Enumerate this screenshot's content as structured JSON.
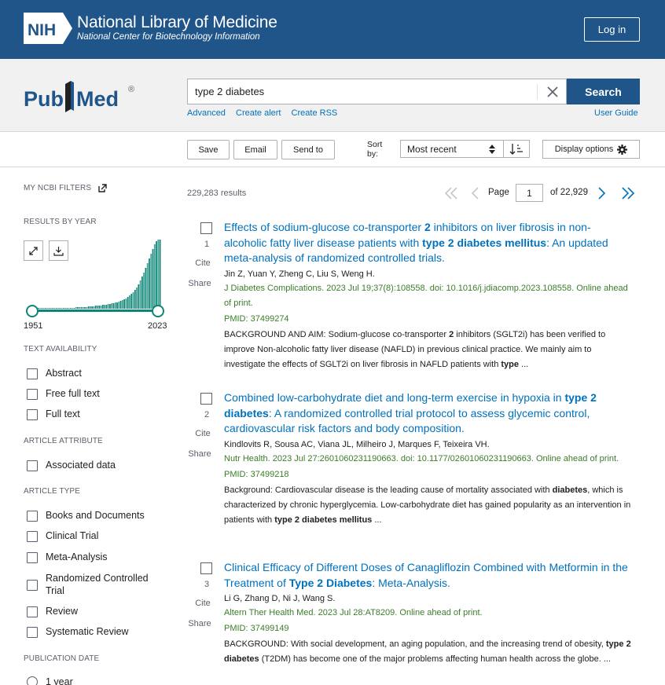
{
  "header": {
    "nih_logo_text": "NIH",
    "title": "National Library of Medicine",
    "subtitle": "National Center for Biotechnology Information",
    "login_label": "Log in"
  },
  "search": {
    "logo_text_pub": "Pub",
    "logo_text_med": "Med",
    "logo_reg": "®",
    "query": "type 2 diabetes",
    "button_label": "Search",
    "links": [
      "Advanced",
      "Create alert",
      "Create RSS"
    ],
    "user_guide": "User Guide"
  },
  "toolbar": {
    "save": "Save",
    "email": "Email",
    "send_to": "Send to",
    "sort_by_label": "Sort by:",
    "sort_value": "Most recent",
    "display_options": "Display options"
  },
  "sidebar": {
    "my_filters": "MY NCBI FILTERS",
    "results_by_year": "RESULTS BY YEAR",
    "year_start": "1951",
    "year_end": "2023",
    "text_availability": "TEXT AVAILABILITY",
    "text_items": [
      "Abstract",
      "Free full text",
      "Full text"
    ],
    "article_attribute": "ARTICLE ATTRIBUTE",
    "attribute_items": [
      "Associated data"
    ],
    "article_type": "ARTICLE TYPE",
    "type_items": [
      "Books and Documents",
      "Clinical Trial",
      "Meta-Analysis",
      "Randomized Controlled Trial",
      "Review",
      "Systematic Review"
    ],
    "publication_date": "PUBLICATION DATE",
    "date_items": [
      "1 year"
    ]
  },
  "results": {
    "count": "229,283 results",
    "page_label": "Page",
    "page_value": "1",
    "page_total": "of 22,929"
  },
  "articles": [
    {
      "num": "1",
      "title_html": "Effects of sodium-glucose co-transporter <b>2</b> inhibitors on liver fibrosis in non-alcoholic fatty liver disease patients with <b>type 2 diabetes mellitus</b>: An updated meta-analysis of randomized controlled trials.",
      "authors": "Jin Z, Yuan Y, Zheng C, Liu S, Weng H.",
      "citation": "J Diabetes Complications. 2023 Jul 19;37(8):108558. doi: 10.1016/j.jdiacomp.2023.108558. Online ahead of print.",
      "pmid": "PMID: 37499274",
      "snippet_html": "BACKGROUND AND AIM: Sodium-glucose co-transporter <b>2</b> inhibitors (SGLT2i) has been verified to improve Non-alcoholic fatty liver disease (NAFLD) in previous clinical practice. We mainly aim to investigate the effects of SGLT2i on liver fibrosis in NAFLD patients with <b>type</b> ..."
    },
    {
      "num": "2",
      "title_html": "Combined low-carbohydrate diet and long-term exercise in hypoxia in <b>type 2 diabetes</b>: A randomized controlled trial protocol to assess glycemic control, cardiovascular risk factors and body composition.",
      "authors": "Kindlovits R, Sousa AC, Viana JL, Milheiro J, Marques F, Teixeira VH.",
      "citation": "Nutr Health. 2023 Jul 27:2601060231190663. doi: 10.1177/02601060231190663. Online ahead of print.",
      "pmid": "PMID: 37499218",
      "snippet_html": "Background: Cardiovascular disease is the leading cause of mortality associated with <b>diabetes</b>, which is characterized by chronic hyperglycemia. Low-carbohydrate diet has gained popularity as an intervention in patients with <b>type 2 diabetes mellitus</b> ..."
    },
    {
      "num": "3",
      "title_html": "Clinical Efficacy of Different Doses of Canagliflozin Combined with Metformin in the Treatment of <b>Type 2 Diabetes</b>: Meta-Analysis.",
      "authors": "Li G, Zhang D, Ni J, Wang S.",
      "citation": "Altern Ther Health Med. 2023 Jul 28:AT8209. Online ahead of print.",
      "pmid": "PMID: 37499149",
      "snippet_html": "BACKGROUND: With social development, an aging population, and the increasing trend of obesity, <b>type 2 diabetes</b> (T2DM) has become one of the major problems affecting human health across the globe. ..."
    }
  ],
  "article_actions": {
    "cite": "Cite",
    "share": "Share"
  },
  "colors": {
    "nih_blue": "#20558a",
    "link": "#0071bc",
    "green": "#3a7d2a",
    "teal": "#0d8577"
  },
  "chart_data": {
    "type": "bar",
    "x_range": [
      1951,
      2023
    ],
    "values": [
      1,
      1,
      1,
      1,
      1,
      1,
      1,
      1,
      1,
      1,
      1,
      1,
      1,
      1,
      1,
      1,
      1,
      1,
      1,
      1,
      1,
      1,
      1,
      1,
      1,
      2,
      2,
      2,
      2,
      2,
      2,
      2,
      3,
      3,
      3,
      3,
      4,
      4,
      4,
      4,
      5,
      5,
      5,
      6,
      6,
      7,
      7,
      8,
      8,
      9,
      10,
      11,
      12,
      13,
      15,
      17,
      19,
      21,
      24,
      27,
      31,
      36,
      41,
      46,
      52,
      58,
      64,
      70,
      76,
      82,
      86,
      88,
      88
    ]
  }
}
